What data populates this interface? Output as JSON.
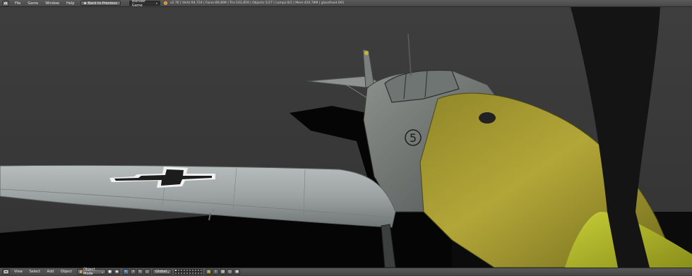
{
  "top_header": {
    "menus": [
      "File",
      "Game",
      "Window",
      "Help"
    ],
    "back_button": "Back to Previous",
    "engine": "Blender Game",
    "stats": "v2.76 | Verts:94,724 | Faces:80,899 | Tris:162,859 | Objects:1/27 | Lamps:0/2 | Mem:420.78M | glassfixed.001"
  },
  "viewport": {
    "wing_cross_color": "#1c1c1c",
    "fuselage_color": "#8a8f8a",
    "nose_color": "#b9a834",
    "background_color": "#3a3a3a",
    "floor_color": "#050505",
    "fuselage_number": "5"
  },
  "bottom_header": {
    "menus": [
      "View",
      "Select",
      "Add",
      "Object"
    ],
    "mode": "Object Mode",
    "orientation": "Global"
  },
  "icons": {
    "editor_type": "editor-type-icon",
    "blender_logo": "blender-logo-icon"
  }
}
